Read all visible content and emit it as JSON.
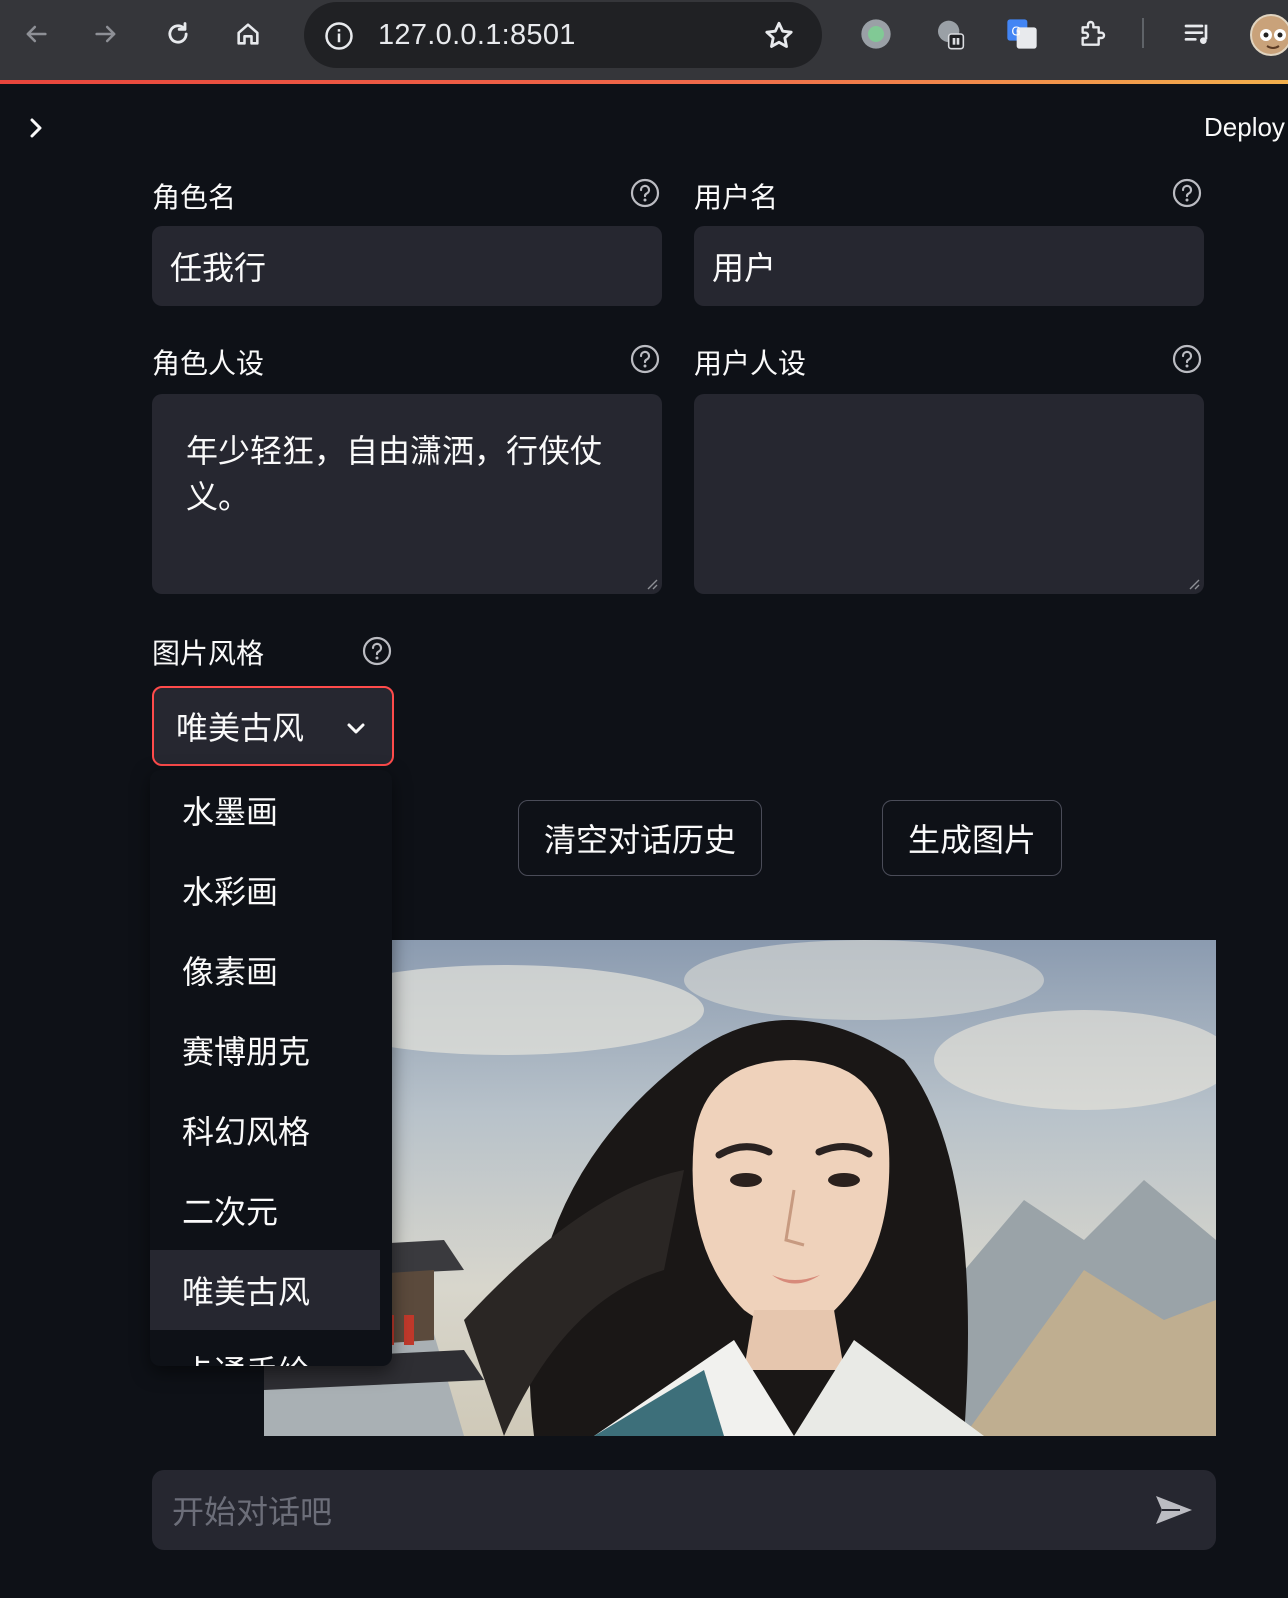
{
  "browser": {
    "url": "127.0.0.1:8501"
  },
  "app": {
    "deploy_label": "Deploy"
  },
  "form": {
    "character_name": {
      "label": "角色名",
      "value": "任我行"
    },
    "user_name": {
      "label": "用户名",
      "value": "用户"
    },
    "character_persona": {
      "label": "角色人设",
      "value": "年少轻狂，自由潇洒，行侠仗义。"
    },
    "user_persona": {
      "label": "用户人设",
      "value": ""
    },
    "image_style": {
      "label": "图片风格",
      "selected": "唯美古风",
      "options": [
        "水墨画",
        "水彩画",
        "像素画",
        "赛博朋克",
        "科幻风格",
        "二次元",
        "唯美古风",
        "卡通手绘"
      ]
    }
  },
  "buttons": {
    "clear_history": "清空对话历史",
    "generate_image": "生成图片"
  },
  "chat": {
    "placeholder": "开始对话吧"
  },
  "colors": {
    "background": "#0e1117",
    "input_bg": "#262730",
    "accent": "#ff4b4b"
  }
}
